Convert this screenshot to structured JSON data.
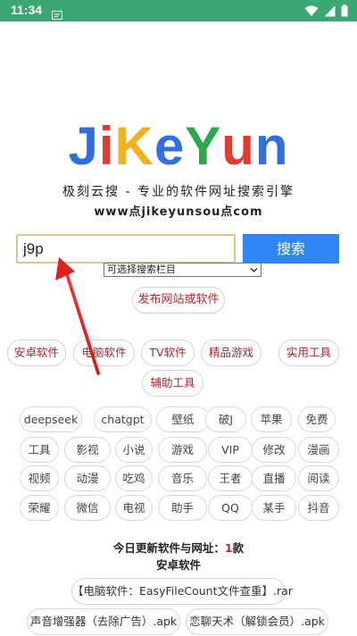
{
  "status": {
    "time": "11:34"
  },
  "logo": {
    "letters": [
      {
        "ch": "J",
        "color": "#2f6fe0"
      },
      {
        "ch": "i",
        "color": "#e53a2f"
      },
      {
        "ch": "K",
        "color": "#f2b01e"
      },
      {
        "ch": "e",
        "color": "#2f6fe0"
      },
      {
        "ch": "Y",
        "color": "#2aa84a"
      },
      {
        "ch": "u",
        "color": "#e53a2f"
      },
      {
        "ch": "n",
        "color": "#2f6fe0"
      }
    ]
  },
  "tagline": "极刻云搜 - 专业的软件网址搜索引擎",
  "site_url": "www点jikeyunsou点com",
  "search": {
    "value": "j9p",
    "button_label": "搜索"
  },
  "category_select": {
    "selected": "可选择搜索栏目"
  },
  "publish_label": "发布网站或软件",
  "categories": [
    "安卓软件",
    "电脑软件",
    "TV软件",
    "精品游戏",
    "实用工具",
    "辅助工具"
  ],
  "tags": [
    [
      "deepseek",
      "chatgpt",
      "壁纸",
      "破J",
      "苹果",
      "免费"
    ],
    [
      "工具",
      "影视",
      "小说",
      "游戏",
      "VIP",
      "修改",
      "漫画"
    ],
    [
      "视频",
      "动漫",
      "吃鸡",
      "音乐",
      "王者",
      "直播",
      "阅读"
    ],
    [
      "荣耀",
      "微信",
      "电视",
      "助手",
      "QQ",
      "某手",
      "抖音"
    ]
  ],
  "update": {
    "prefix": "今日更新软件与网址：",
    "count": "1",
    "suffix": "款",
    "section": "安卓软件"
  },
  "files": [
    "【电脑软件：EasyFileCount文件查重】.rar",
    "声音增强器（去除广告）.apk",
    "恋聊天术（解锁会员）.apk"
  ],
  "colors": {
    "status_bar": "#3aa870",
    "search_button": "#2f86f6",
    "accent_red": "#c0262c"
  }
}
